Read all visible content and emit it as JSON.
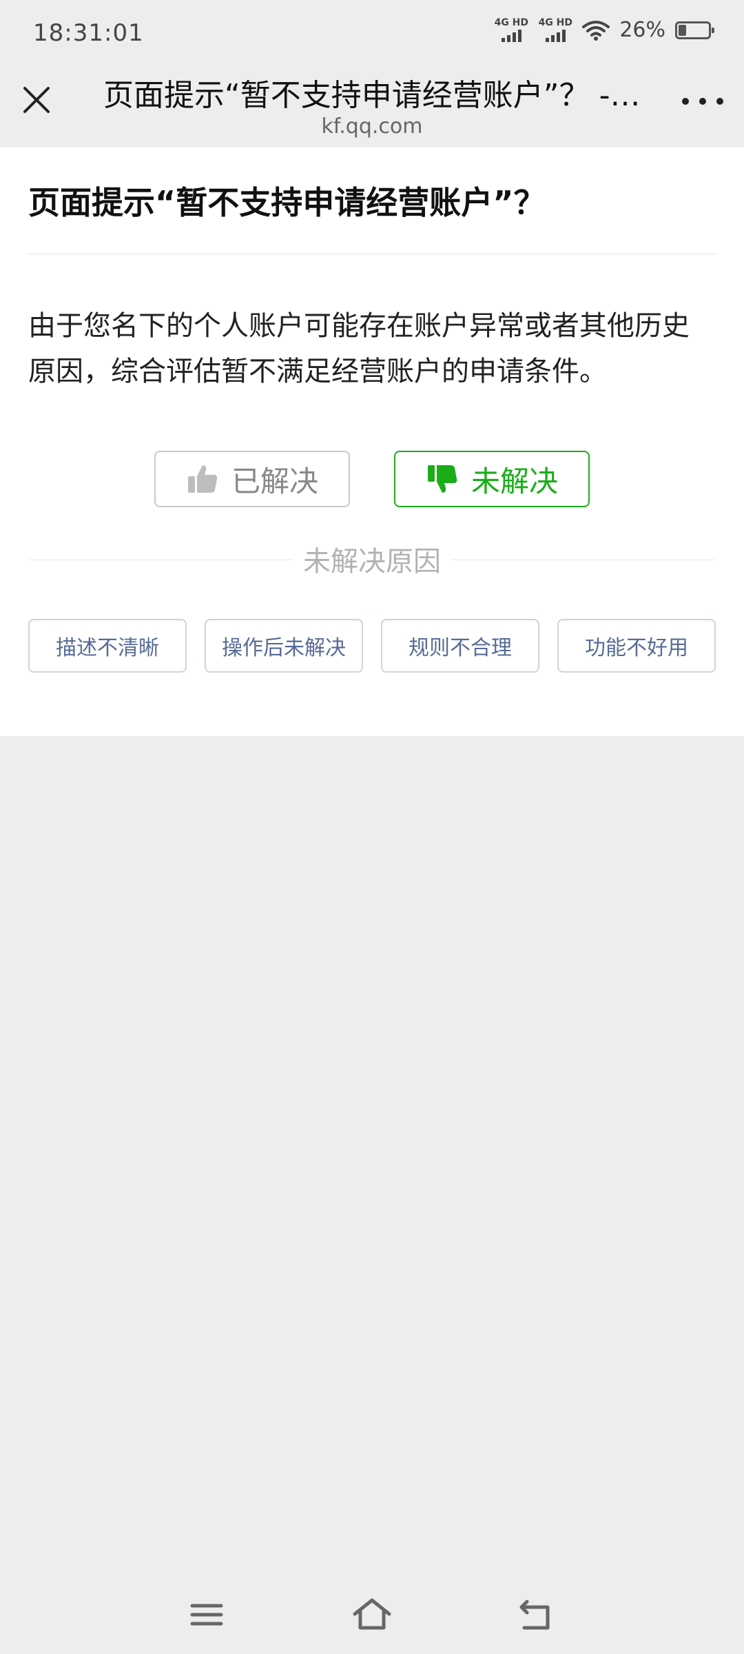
{
  "status_bar": {
    "time": "18:31:01",
    "net1": "4G HD",
    "net2": "4G HD",
    "battery": "26%",
    "battery_level": 0.26
  },
  "nav": {
    "title": "页面提示“暂不支持申请经营账户”？ - 微信支付",
    "domain": "kf.qq.com"
  },
  "article": {
    "title": "页面提示“暂不支持申请经营账户”？",
    "body": "由于您名下的个人账户可能存在账户异常或者其他历史原因，综合评估暂不满足经营账户的申请条件。"
  },
  "feedback": {
    "resolved_label": "已解决",
    "unresolved_label": "未解决",
    "selected": "unresolved",
    "reason_title": "未解决原因",
    "reasons": [
      "描述不清晰",
      "操作后未解决",
      "规则不合理",
      "功能不好用"
    ]
  },
  "colors": {
    "accent": "#1aad19",
    "link": "#576b95",
    "background": "#ededed"
  },
  "icons": {
    "close": "close-icon",
    "more": "more-icon",
    "thumbs_up": "thumbs-up-icon",
    "thumbs_down": "thumbs-down-icon",
    "menu": "menu-icon",
    "home": "home-icon",
    "back": "back-icon"
  }
}
